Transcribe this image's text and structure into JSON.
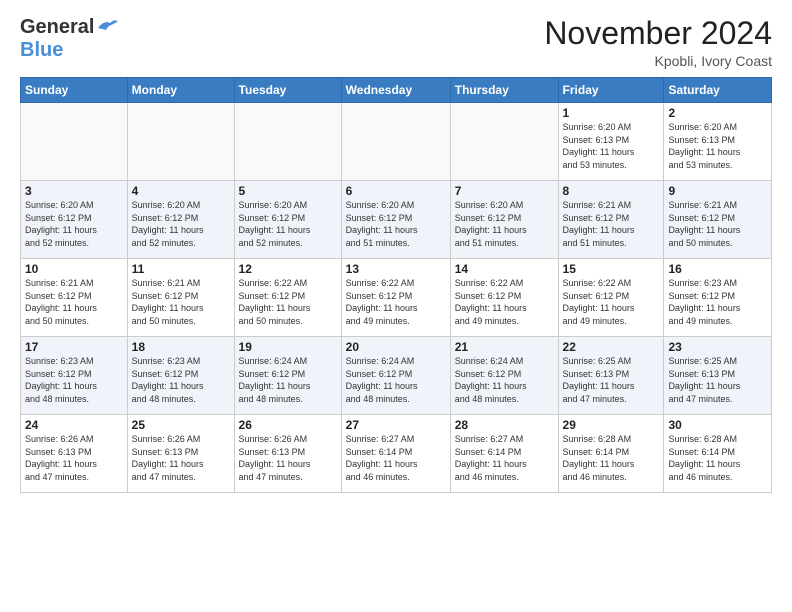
{
  "header": {
    "logo_general": "General",
    "logo_blue": "Blue",
    "month": "November 2024",
    "location": "Kpobli, Ivory Coast"
  },
  "weekdays": [
    "Sunday",
    "Monday",
    "Tuesday",
    "Wednesday",
    "Thursday",
    "Friday",
    "Saturday"
  ],
  "weeks": [
    [
      {
        "day": "",
        "info": ""
      },
      {
        "day": "",
        "info": ""
      },
      {
        "day": "",
        "info": ""
      },
      {
        "day": "",
        "info": ""
      },
      {
        "day": "",
        "info": ""
      },
      {
        "day": "1",
        "info": "Sunrise: 6:20 AM\nSunset: 6:13 PM\nDaylight: 11 hours\nand 53 minutes."
      },
      {
        "day": "2",
        "info": "Sunrise: 6:20 AM\nSunset: 6:13 PM\nDaylight: 11 hours\nand 53 minutes."
      }
    ],
    [
      {
        "day": "3",
        "info": "Sunrise: 6:20 AM\nSunset: 6:12 PM\nDaylight: 11 hours\nand 52 minutes."
      },
      {
        "day": "4",
        "info": "Sunrise: 6:20 AM\nSunset: 6:12 PM\nDaylight: 11 hours\nand 52 minutes."
      },
      {
        "day": "5",
        "info": "Sunrise: 6:20 AM\nSunset: 6:12 PM\nDaylight: 11 hours\nand 52 minutes."
      },
      {
        "day": "6",
        "info": "Sunrise: 6:20 AM\nSunset: 6:12 PM\nDaylight: 11 hours\nand 51 minutes."
      },
      {
        "day": "7",
        "info": "Sunrise: 6:20 AM\nSunset: 6:12 PM\nDaylight: 11 hours\nand 51 minutes."
      },
      {
        "day": "8",
        "info": "Sunrise: 6:21 AM\nSunset: 6:12 PM\nDaylight: 11 hours\nand 51 minutes."
      },
      {
        "day": "9",
        "info": "Sunrise: 6:21 AM\nSunset: 6:12 PM\nDaylight: 11 hours\nand 50 minutes."
      }
    ],
    [
      {
        "day": "10",
        "info": "Sunrise: 6:21 AM\nSunset: 6:12 PM\nDaylight: 11 hours\nand 50 minutes."
      },
      {
        "day": "11",
        "info": "Sunrise: 6:21 AM\nSunset: 6:12 PM\nDaylight: 11 hours\nand 50 minutes."
      },
      {
        "day": "12",
        "info": "Sunrise: 6:22 AM\nSunset: 6:12 PM\nDaylight: 11 hours\nand 50 minutes."
      },
      {
        "day": "13",
        "info": "Sunrise: 6:22 AM\nSunset: 6:12 PM\nDaylight: 11 hours\nand 49 minutes."
      },
      {
        "day": "14",
        "info": "Sunrise: 6:22 AM\nSunset: 6:12 PM\nDaylight: 11 hours\nand 49 minutes."
      },
      {
        "day": "15",
        "info": "Sunrise: 6:22 AM\nSunset: 6:12 PM\nDaylight: 11 hours\nand 49 minutes."
      },
      {
        "day": "16",
        "info": "Sunrise: 6:23 AM\nSunset: 6:12 PM\nDaylight: 11 hours\nand 49 minutes."
      }
    ],
    [
      {
        "day": "17",
        "info": "Sunrise: 6:23 AM\nSunset: 6:12 PM\nDaylight: 11 hours\nand 48 minutes."
      },
      {
        "day": "18",
        "info": "Sunrise: 6:23 AM\nSunset: 6:12 PM\nDaylight: 11 hours\nand 48 minutes."
      },
      {
        "day": "19",
        "info": "Sunrise: 6:24 AM\nSunset: 6:12 PM\nDaylight: 11 hours\nand 48 minutes."
      },
      {
        "day": "20",
        "info": "Sunrise: 6:24 AM\nSunset: 6:12 PM\nDaylight: 11 hours\nand 48 minutes."
      },
      {
        "day": "21",
        "info": "Sunrise: 6:24 AM\nSunset: 6:12 PM\nDaylight: 11 hours\nand 48 minutes."
      },
      {
        "day": "22",
        "info": "Sunrise: 6:25 AM\nSunset: 6:13 PM\nDaylight: 11 hours\nand 47 minutes."
      },
      {
        "day": "23",
        "info": "Sunrise: 6:25 AM\nSunset: 6:13 PM\nDaylight: 11 hours\nand 47 minutes."
      }
    ],
    [
      {
        "day": "24",
        "info": "Sunrise: 6:26 AM\nSunset: 6:13 PM\nDaylight: 11 hours\nand 47 minutes."
      },
      {
        "day": "25",
        "info": "Sunrise: 6:26 AM\nSunset: 6:13 PM\nDaylight: 11 hours\nand 47 minutes."
      },
      {
        "day": "26",
        "info": "Sunrise: 6:26 AM\nSunset: 6:13 PM\nDaylight: 11 hours\nand 47 minutes."
      },
      {
        "day": "27",
        "info": "Sunrise: 6:27 AM\nSunset: 6:14 PM\nDaylight: 11 hours\nand 46 minutes."
      },
      {
        "day": "28",
        "info": "Sunrise: 6:27 AM\nSunset: 6:14 PM\nDaylight: 11 hours\nand 46 minutes."
      },
      {
        "day": "29",
        "info": "Sunrise: 6:28 AM\nSunset: 6:14 PM\nDaylight: 11 hours\nand 46 minutes."
      },
      {
        "day": "30",
        "info": "Sunrise: 6:28 AM\nSunset: 6:14 PM\nDaylight: 11 hours\nand 46 minutes."
      }
    ]
  ]
}
